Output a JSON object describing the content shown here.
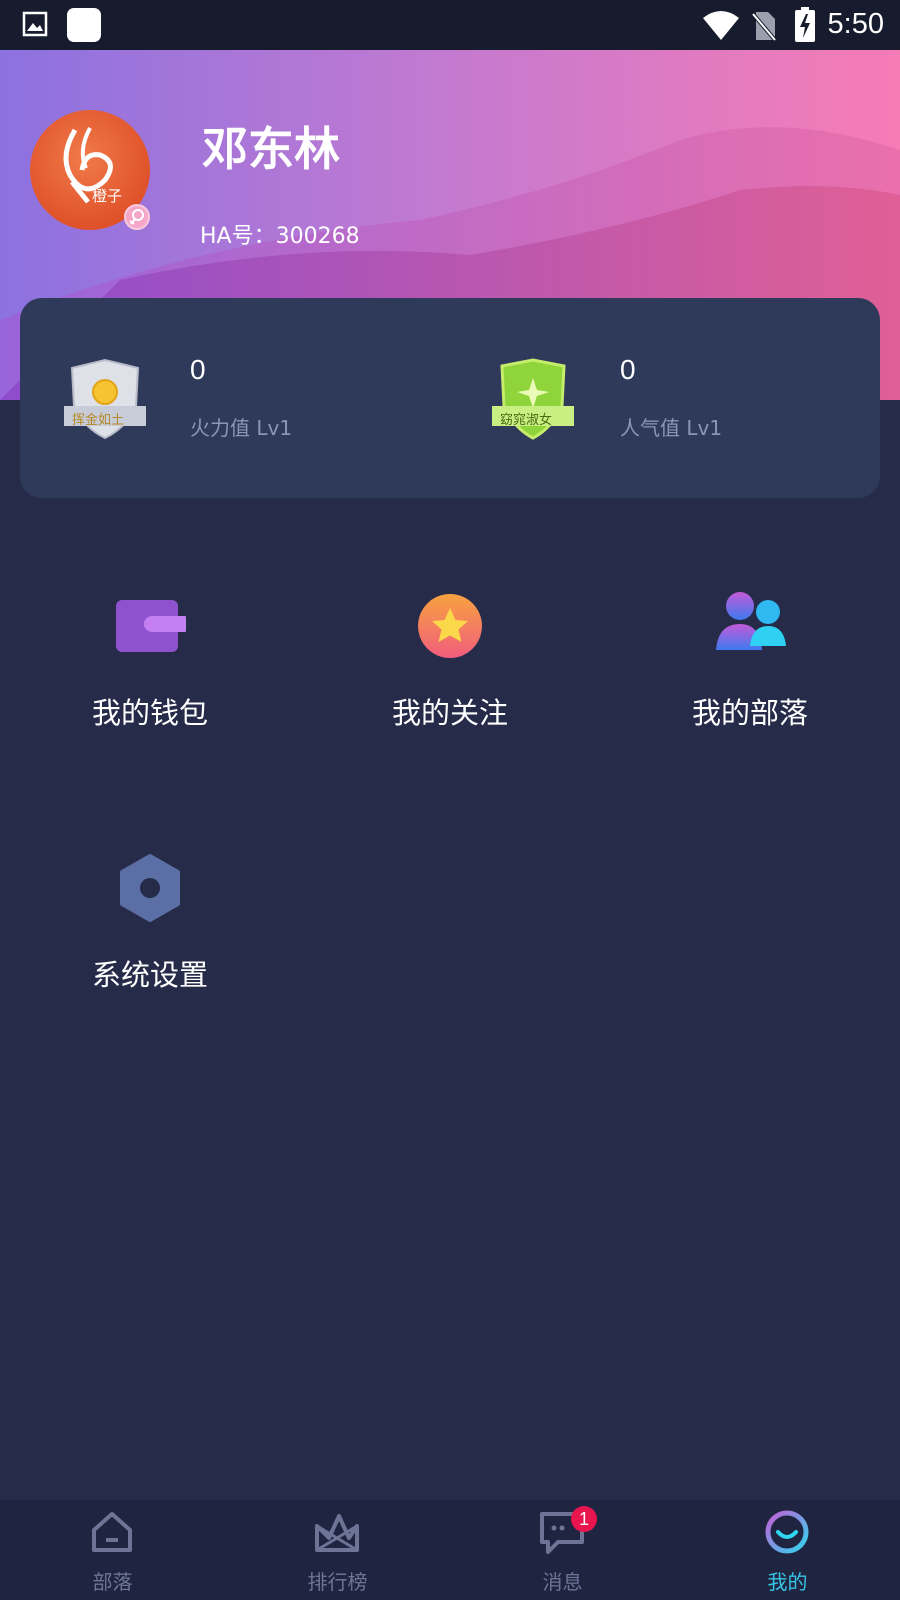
{
  "status_bar": {
    "time": "5:50",
    "icons": [
      "image-icon",
      "app-square-icon",
      "wifi-icon",
      "no-sim-icon",
      "battery-charging-icon"
    ]
  },
  "profile": {
    "avatar_text": "橙子",
    "name": "邓东林",
    "ha_id": "HA号：300268",
    "gender_icon": "female-icon"
  },
  "stats": [
    {
      "value": "0",
      "label": "火力值 Lv1",
      "badge_text": "挥金如土",
      "badge_icon": "silver-shield-badge-icon"
    },
    {
      "value": "0",
      "label": "人气值 Lv1",
      "badge_text": "窈窕淑女",
      "badge_icon": "green-shield-badge-icon"
    }
  ],
  "menu": [
    {
      "label": "我的钱包",
      "icon": "wallet-icon"
    },
    {
      "label": "我的关注",
      "icon": "star-icon"
    },
    {
      "label": "我的部落",
      "icon": "group-users-icon"
    },
    {
      "label": "系统设置",
      "icon": "settings-hex-icon"
    }
  ],
  "bottom_nav": {
    "items": [
      {
        "label": "部落",
        "icon": "home-icon",
        "active": false
      },
      {
        "label": "排行榜",
        "icon": "crown-icon",
        "active": false
      },
      {
        "label": "消息",
        "icon": "message-icon",
        "active": false,
        "badge": "1"
      },
      {
        "label": "我的",
        "icon": "smile-ring-icon",
        "active": true
      }
    ]
  },
  "colors": {
    "background": "#252b48",
    "card": "#2f3a5b",
    "accent": "#35c4e6",
    "badge_red": "#e8154e",
    "banner_start": "#8c6fe0",
    "banner_end": "#f779b4"
  }
}
